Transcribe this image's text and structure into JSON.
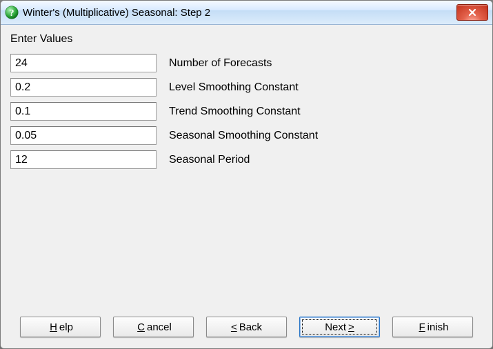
{
  "window": {
    "title": "Winter's (Multiplicative) Seasonal: Step 2"
  },
  "section_label": "Enter Values",
  "fields": {
    "num_forecasts": {
      "value": "24",
      "label": "Number of Forecasts"
    },
    "level_smooth": {
      "value": "0.2",
      "label": "Level Smoothing Constant"
    },
    "trend_smooth": {
      "value": "0.1",
      "label": "Trend Smoothing Constant"
    },
    "seasonal_smooth": {
      "value": "0.05",
      "label": "Seasonal Smoothing Constant"
    },
    "seasonal_period": {
      "value": "12",
      "label": "Seasonal Period"
    }
  },
  "buttons": {
    "help": {
      "pre": "",
      "mnemonic": "H",
      "post": "elp"
    },
    "cancel": {
      "pre": "",
      "mnemonic": "C",
      "post": "ancel"
    },
    "back": {
      "pre": "",
      "mnemonic": "<",
      "post": " Back"
    },
    "next": {
      "pre": "Next ",
      "mnemonic": ">",
      "post": ""
    },
    "finish": {
      "pre": "",
      "mnemonic": "F",
      "post": "inish"
    }
  }
}
